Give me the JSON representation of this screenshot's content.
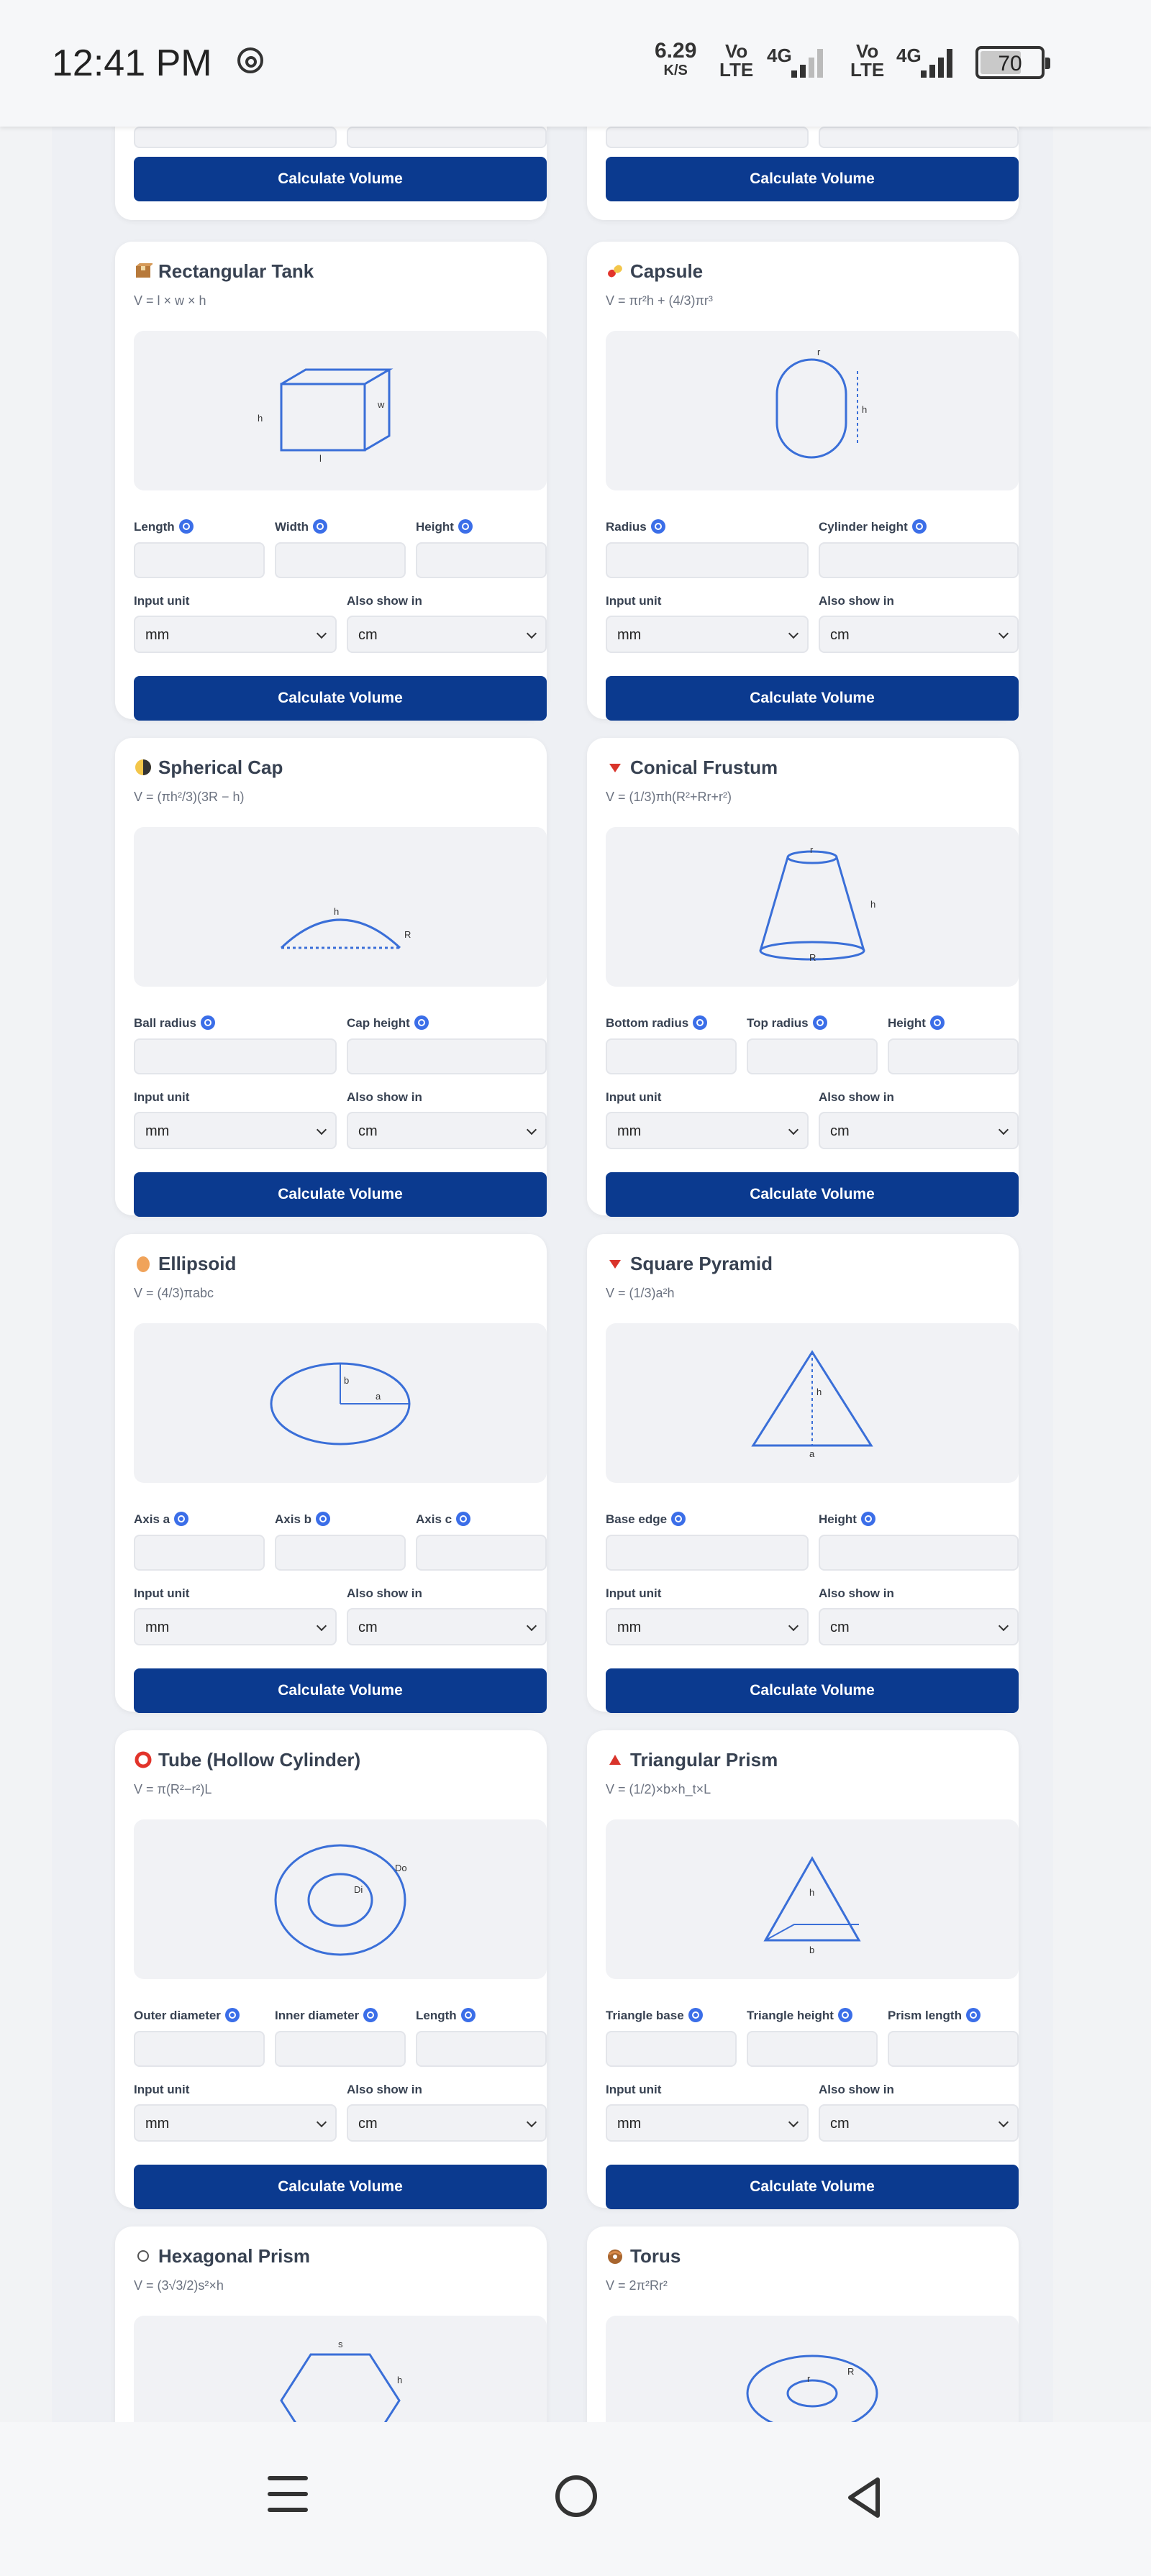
{
  "status_bar": {
    "time": "12:41 PM",
    "speed_value": "6.29",
    "speed_unit": "K/S",
    "sim1_vo": "Vo",
    "sim1_lte": "LTE",
    "sim1_net": "4G",
    "sim2_vo": "Vo",
    "sim2_lte": "LTE",
    "sim2_net": "4G",
    "battery": "70",
    "battery_level_percent": 70
  },
  "shared": {
    "input_unit_label": "Input unit",
    "also_show_label": "Also show in",
    "input_unit_value": "mm",
    "also_show_value": "cm",
    "calculate_label": "Calculate Volume"
  },
  "cards": {
    "rectangular_tank": {
      "title": "Rectangular Tank",
      "icon": "package-icon",
      "formula": "V = l × w × h",
      "fields": [
        "Length",
        "Width",
        "Height"
      ],
      "diagram_labels": [
        "h",
        "w",
        "l"
      ]
    },
    "capsule": {
      "title": "Capsule",
      "icon": "pill-icon",
      "formula": "V = πr²h + (4/3)πr³",
      "fields": [
        "Radius",
        "Cylinder height"
      ],
      "diagram_labels": [
        "r",
        "h"
      ]
    },
    "spherical_cap": {
      "title": "Spherical Cap",
      "icon": "half-moon-icon",
      "formula": "V = (πh²/3)(3R − h)",
      "fields": [
        "Ball radius",
        "Cap height"
      ],
      "diagram_labels": [
        "h",
        "R"
      ]
    },
    "conical_frustum": {
      "title": "Conical Frustum",
      "icon": "red-triangle-down-icon",
      "formula": "V = (1/3)πh(R²+Rr+r²)",
      "fields": [
        "Bottom radius",
        "Top radius",
        "Height"
      ],
      "diagram_labels": [
        "r",
        "h",
        "R"
      ]
    },
    "ellipsoid": {
      "title": "Ellipsoid",
      "icon": "egg-icon",
      "formula": "V = (4/3)πabc",
      "fields": [
        "Axis a",
        "Axis b",
        "Axis c"
      ],
      "diagram_labels": [
        "b",
        "a"
      ]
    },
    "square_pyramid": {
      "title": "Square Pyramid",
      "icon": "red-triangle-down-icon",
      "formula": "V = (1/3)a²h",
      "fields": [
        "Base edge",
        "Height"
      ],
      "diagram_labels": [
        "h",
        "a"
      ]
    },
    "tube": {
      "title": "Tube (Hollow Cylinder)",
      "icon": "red-ring-icon",
      "formula": "V = π(R²−r²)L",
      "fields": [
        "Outer diameter",
        "Inner diameter",
        "Length"
      ],
      "diagram_labels": [
        "Do",
        "Di"
      ]
    },
    "triangular_prism": {
      "title": "Triangular Prism",
      "icon": "red-triangle-up-icon",
      "formula": "V = (1/2)×b×h_t×L",
      "fields": [
        "Triangle base",
        "Triangle height",
        "Prism length"
      ],
      "diagram_labels": [
        "h",
        "b"
      ]
    },
    "hexagonal_prism": {
      "title": "Hexagonal Prism",
      "icon": "white-circle-icon",
      "formula": "V = (3√3/2)s²×h",
      "diagram_labels": [
        "s",
        "h"
      ]
    },
    "torus": {
      "title": "Torus",
      "icon": "donut-icon",
      "formula": "V = 2π²Rr²",
      "diagram_labels": [
        "r",
        "R"
      ]
    }
  },
  "colors": {
    "button": "#0b3a8f",
    "diagram_stroke": "#3a6fd8",
    "info_icon": "#3b6ee8",
    "background": "#eef0f4"
  }
}
